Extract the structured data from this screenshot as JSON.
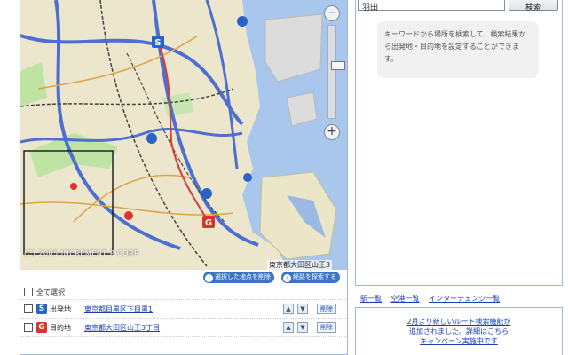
{
  "map": {
    "copyright": "(C) 2005 INCREMENT P CORP.",
    "scale_text": "東京都大田区山王3",
    "zoom_in": "−",
    "zoom_out": "+"
  },
  "map_actions": {
    "btn1": "選択した地点を削除",
    "btn2": "経路を探索する"
  },
  "route": {
    "select_all_label": "全て選択",
    "start": {
      "badge": "S",
      "badge_color": "#2a63c7",
      "type": "出発地",
      "address": "東京都目黒区下目黒1"
    },
    "goal": {
      "badge": "G",
      "badge_color": "#e0312a",
      "type": "目的地",
      "address": "東京都大田区山王3丁目"
    },
    "move_up": "▲",
    "move_down": "▼",
    "delete": "削除"
  },
  "search": {
    "input_value": "羽田",
    "button_label": "検索",
    "hint": "キーワードから場所を検索して、検索結果から出発地・目的地を設定することができます。"
  },
  "links": [
    "駅一覧",
    "空港一覧",
    "インターチェンジ一覧"
  ],
  "news": [
    "2月より新しいルート検索機能が",
    "追加されました。詳細はこちら",
    "キャンペーン実施中です"
  ]
}
